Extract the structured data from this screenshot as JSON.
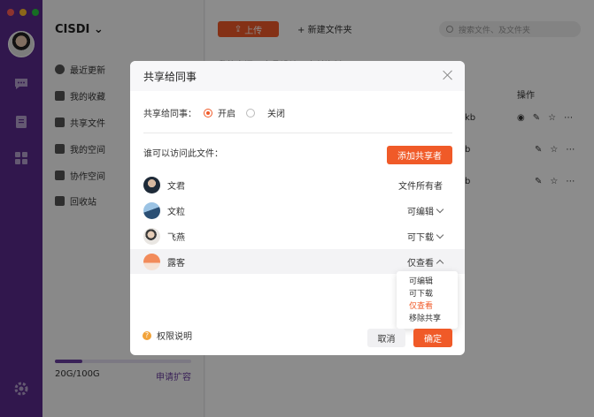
{
  "app": {
    "brand": "CISDI",
    "colors": {
      "rail": "#5a2b8c",
      "accent": "#f05a28",
      "link": "#6b3fa0"
    }
  },
  "sidebar": {
    "items": [
      {
        "label": "最近更新",
        "icon": "clock-icon"
      },
      {
        "label": "我的收藏",
        "icon": "star-icon"
      },
      {
        "label": "共享文件",
        "icon": "folder-icon"
      },
      {
        "label": "我的空间",
        "icon": "home-icon"
      },
      {
        "label": "协作空间",
        "icon": "cube-icon"
      },
      {
        "label": "回收站",
        "icon": "trash-icon"
      }
    ],
    "storage": {
      "used_text": "20G/100G",
      "used_fraction": 0.2,
      "expand_link": "申请扩容"
    }
  },
  "toolbar": {
    "upload_label": "上传",
    "new_folder_label": "新建文件夹",
    "search_placeholder": "搜索文件、及文件夹"
  },
  "main": {
    "breadcrumb": "我的空间 › 产品设计 › 交付资料",
    "ops_header": "操作",
    "rows": [
      {
        "size": "kb"
      },
      {
        "size": "b"
      },
      {
        "size": "b"
      }
    ]
  },
  "modal": {
    "title": "共享给同事",
    "share_label": "共享给同事：",
    "option_on": "开启",
    "option_off": "关闭",
    "access_label": "谁可以访问此文件：",
    "add_button": "添加共享者",
    "users": [
      {
        "name": "文君",
        "permission": "文件所有者"
      },
      {
        "name": "文粒",
        "permission": "可编辑"
      },
      {
        "name": "飞燕",
        "permission": "可下载"
      },
      {
        "name": "露客",
        "permission": "仅查看"
      }
    ],
    "dropdown": [
      "可编辑",
      "可下载",
      "仅查看",
      "移除共享"
    ],
    "help_label": "权限说明",
    "cancel_label": "取消",
    "ok_label": "确定"
  }
}
